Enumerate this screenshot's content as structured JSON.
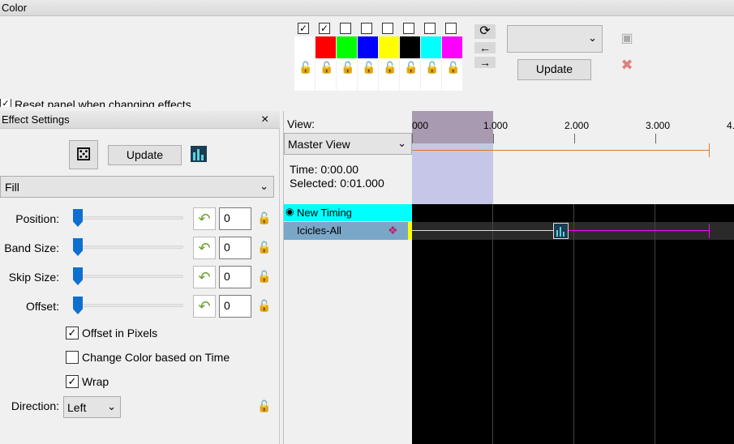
{
  "color_panel": {
    "title": "Color",
    "colors": [
      "#ffffff",
      "#ff0000",
      "#00ff00",
      "#0000ff",
      "#ffff00",
      "#000000",
      "#00ffff",
      "#ff00ff"
    ],
    "checked": [
      true,
      true,
      false,
      false,
      false,
      false,
      false,
      false
    ],
    "update_label": "Update",
    "select_value": "",
    "reset_label": "Reset panel when changing effects"
  },
  "effect_settings": {
    "title": "Effect Settings",
    "close": "×",
    "update_label": "Update",
    "effect_type": "Fill",
    "params": [
      {
        "label": "Position:",
        "value": "0"
      },
      {
        "label": "Band Size:",
        "value": "0"
      },
      {
        "label": "Skip Size:",
        "value": "0"
      },
      {
        "label": "Offset:",
        "value": "0"
      }
    ],
    "offset_in_pixels": {
      "label": "Offset in Pixels",
      "checked": true
    },
    "change_color": {
      "label": "Change Color based on Time",
      "checked": false
    },
    "wrap": {
      "label": "Wrap",
      "checked": true
    },
    "direction_label": "Direction:",
    "direction_value": "Left"
  },
  "timeline": {
    "view_label": "View:",
    "view_value": "Master View",
    "time": "Time: 0:00.00",
    "selected": "Selected: 0:01.000",
    "ticks": [
      "000",
      "1.000",
      "2.000",
      "3.000",
      "4."
    ],
    "rows": [
      {
        "name": "New Timing"
      },
      {
        "name": "Icicles-All"
      }
    ]
  }
}
